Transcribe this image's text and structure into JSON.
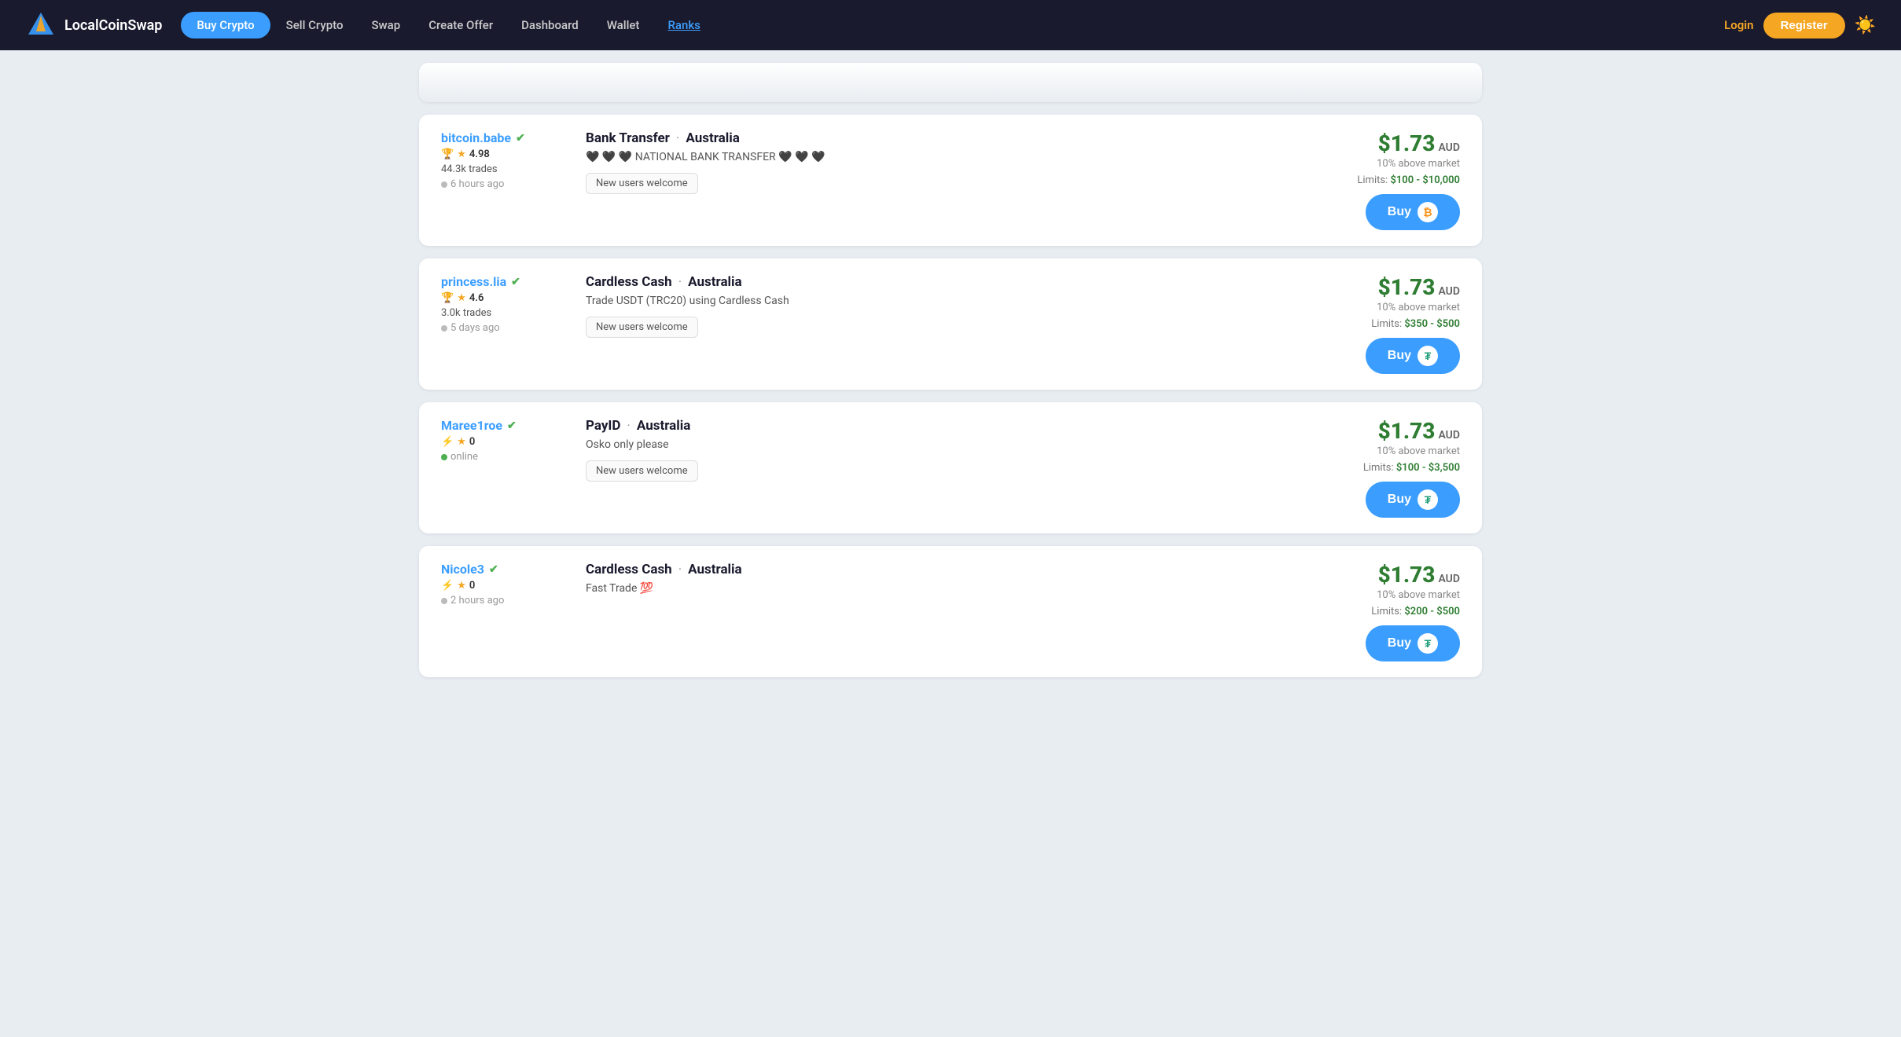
{
  "navbar": {
    "logo_text": "LocalCoinSwap",
    "links": [
      {
        "id": "buy-crypto",
        "label": "Buy Crypto",
        "active": true
      },
      {
        "id": "sell-crypto",
        "label": "Sell Crypto",
        "active": false
      },
      {
        "id": "swap",
        "label": "Swap",
        "active": false
      },
      {
        "id": "create-offer",
        "label": "Create Offer",
        "active": false
      },
      {
        "id": "dashboard",
        "label": "Dashboard",
        "active": false
      },
      {
        "id": "wallet",
        "label": "Wallet",
        "active": false
      },
      {
        "id": "ranks",
        "label": "Ranks",
        "active": false,
        "special": "ranks"
      }
    ],
    "login_label": "Login",
    "register_label": "Register",
    "sun_icon": "☀️"
  },
  "offers": [
    {
      "id": "offer-partial",
      "partial": true
    },
    {
      "id": "offer-bitcoin-babe",
      "seller_name": "bitcoin.babe",
      "seller_verified": true,
      "seller_badge": "trophy",
      "seller_rating": "4.98",
      "seller_trades": "44.3k trades",
      "seller_time": "6 hours ago",
      "seller_online": false,
      "payment_method": "Bank Transfer",
      "location": "Australia",
      "description": "🖤 🖤 🖤 NATIONAL BANK TRANSFER 🖤 🖤 🖤",
      "tag": "New users welcome",
      "price": "$1.73",
      "currency": "AUD",
      "above_market": "10% above market",
      "limits": "$100 - $10,000",
      "coin": "btc",
      "coin_symbol": "₿"
    },
    {
      "id": "offer-princess-lia",
      "seller_name": "princess.lia",
      "seller_verified": true,
      "seller_badge": "trophy",
      "seller_rating": "4.6",
      "seller_trades": "3.0k trades",
      "seller_time": "5 days ago",
      "seller_online": false,
      "payment_method": "Cardless Cash",
      "location": "Australia",
      "description": "Trade USDT (TRC20) using Cardless Cash",
      "tag": "New users welcome",
      "price": "$1.73",
      "currency": "AUD",
      "above_market": "10% above market",
      "limits": "$350 - $500",
      "coin": "usdt",
      "coin_symbol": "₮"
    },
    {
      "id": "offer-maree1roe",
      "seller_name": "Maree1roe",
      "seller_verified": true,
      "seller_badge": "bolt",
      "seller_rating": "0",
      "seller_trades": "",
      "seller_time": "online",
      "seller_online": true,
      "payment_method": "PayID",
      "location": "Australia",
      "description": "Osko only please",
      "tag": "New users welcome",
      "price": "$1.73",
      "currency": "AUD",
      "above_market": "10% above market",
      "limits": "$100 - $3,500",
      "coin": "usdt",
      "coin_symbol": "₮"
    },
    {
      "id": "offer-nicole3",
      "seller_name": "Nicole3",
      "seller_verified": true,
      "seller_badge": "bolt",
      "seller_rating": "0",
      "seller_trades": "",
      "seller_time": "2 hours ago",
      "seller_online": false,
      "payment_method": "Cardless Cash",
      "location": "Australia",
      "description": "Fast Trade 💯",
      "tag": "",
      "price": "$1.73",
      "currency": "AUD",
      "above_market": "10% above market",
      "limits": "$200 - $500",
      "coin": "usdt",
      "coin_symbol": "₮"
    }
  ],
  "ui": {
    "buy_button_label": "Buy",
    "limits_prefix": "Limits: ",
    "verified_symbol": "✔",
    "above_label": "above market"
  }
}
